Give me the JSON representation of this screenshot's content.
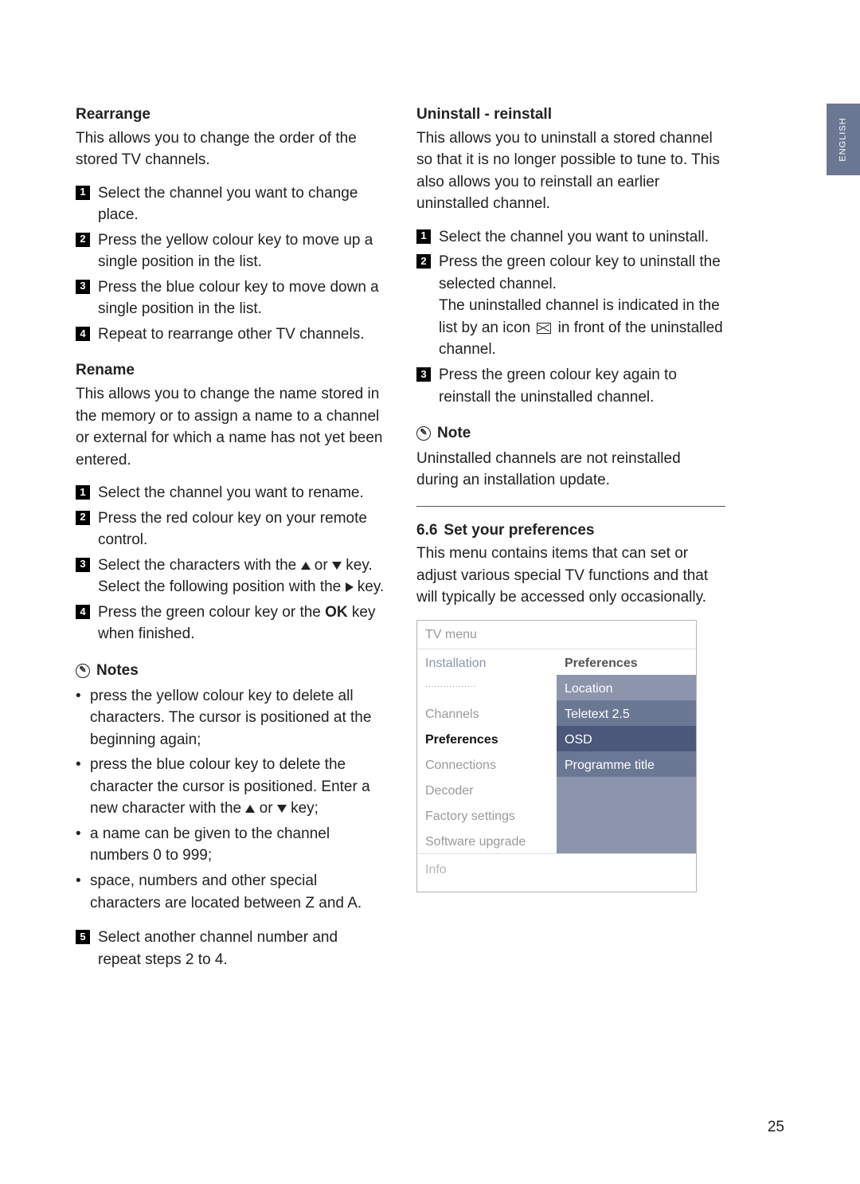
{
  "langTab": "ENGLISH",
  "pageNumber": "25",
  "left": {
    "rearrange": {
      "title": "Rearrange",
      "intro": "This allows you to change the order of the stored TV channels.",
      "steps": [
        "Select the channel you want to change place.",
        "Press the yellow colour key  to move up a single position in the list.",
        "Press the blue colour key to move down a single position in the list.",
        "Repeat to rearrange other TV channels."
      ]
    },
    "rename": {
      "title": "Rename",
      "intro": "This allows you to change the name stored in the memory or to assign a name to a channel or external for which a name has not yet been entered.",
      "steps": [
        "Select the channel you want to rename.",
        "Press the red colour key on your remote control.",
        {
          "pre": "Select the characters with the ",
          "mid": " or ",
          "post": " key. Select the following position with the ",
          "tail": " key."
        },
        {
          "pre": "Press the green colour key or the ",
          "bold": "OK",
          "post": " key when finished."
        }
      ],
      "notesTitle": "Notes",
      "notes": [
        "press the yellow colour key to delete all characters. The cursor is positioned at the beginning again;",
        {
          "pre": "press the blue colour key to delete the character the cursor is positioned. Enter a new character with the ",
          "mid": " or ",
          "post": " key;"
        },
        "a name can be given to the channel numbers 0 to 999;",
        "space, numbers and other special characters are located between Z and A."
      ],
      "step5": "Select another channel number and repeat steps 2 to 4."
    }
  },
  "right": {
    "uninstall": {
      "title": "Uninstall - reinstall",
      "intro": "This allows you to uninstall a stored channel so that it is no longer possible to tune to. This also allows you to reinstall an earlier uninstalled channel.",
      "steps": [
        "Select the channel you want to uninstall.",
        {
          "pre": "Press the green colour key to uninstall the selected channel.",
          "sub": "The uninstalled channel is indicated in the list by an icon ",
          "subTail": " in front of the uninstalled channel."
        },
        "Press the green colour key again to reinstall the uninstalled channel."
      ],
      "noteTitle": "Note",
      "noteBody": "Uninstalled channels are not reinstalled during an installation update."
    },
    "prefs": {
      "secNum": "6.6",
      "title": "Set your preferences",
      "intro": "This menu contains items that can set or adjust various special TV functions and that will typically be accessed only occasionally."
    },
    "tvMenu": {
      "title": "TV menu",
      "leftHeader": "Installation",
      "leftItems": [
        "Channels",
        "Preferences",
        "Connections",
        "Decoder",
        "Factory settings",
        "Software upgrade"
      ],
      "rightHeader": "Preferences",
      "rightItems": [
        "Location",
        "Teletext 2.5",
        "OSD",
        "Programme title"
      ],
      "info": "Info"
    }
  }
}
